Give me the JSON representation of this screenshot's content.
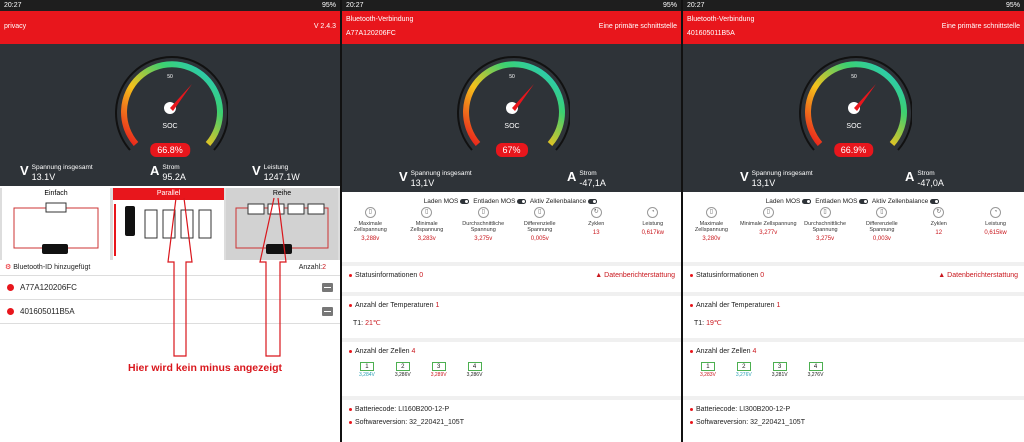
{
  "screen1": {
    "status_time": "20:27",
    "status_right": "95%",
    "header_left": "privacy",
    "header_right": "V 2.4.3",
    "soc_label": "SOC",
    "soc_value": "66.8%",
    "voltage": {
      "label": "Spannung insgesamt",
      "value": "13.1V"
    },
    "current": {
      "label": "Strom",
      "value": "95.2A"
    },
    "power": {
      "label": "Leistung",
      "value": "1247.1W"
    },
    "modes": {
      "single": "Einfach",
      "parallel": "Parallel",
      "series": "Reihe"
    },
    "list_header": "Bluetooth-ID hinzugefügt",
    "count_label": "Anzahl:",
    "count_value": "2",
    "devices": [
      "A77A120206FC",
      "401605011B5A"
    ],
    "annotation": "Hier wird kein minus angezeigt"
  },
  "screen2": {
    "status_time": "20:27",
    "status_right": "95%",
    "header_title": "Bluetooth-Verbindung",
    "header_id": "A77A120206FC",
    "header_right": "Eine primäre schnittstelle",
    "soc_label": "SOC",
    "soc_value": "67%",
    "voltage": {
      "label": "Spannung insgesamt",
      "value": "13,1V"
    },
    "current": {
      "label": "Strom",
      "value": "-47,1A"
    },
    "mos": {
      "charge": "Laden MOS",
      "discharge": "Entladen MOS",
      "balance": "Aktiv Zellenbalance"
    },
    "stats": [
      {
        "label": "Maximale Zellspannung",
        "value": "3,288v"
      },
      {
        "label": "Minimale Zellspannung",
        "value": "3,283v"
      },
      {
        "label": "Durchschnittliche Spannung",
        "value": "3,275v"
      },
      {
        "label": "Differenzielle Spannung",
        "value": "0,005v"
      },
      {
        "label": "Zyklen",
        "value": "13"
      },
      {
        "label": "Leistung",
        "value": "0,617kw"
      }
    ],
    "status_info_label": "Statusinformationen",
    "status_info_value": "0",
    "report_label": "Datenberichterstattung",
    "temp_count_label": "Anzahl der Temperaturen",
    "temp_count_value": "1",
    "temp_label": "T1:",
    "temp_value": "21℃",
    "cell_count_label": "Anzahl der Zellen",
    "cell_count_value": "4",
    "cells": [
      {
        "num": "1",
        "v": "3,284V"
      },
      {
        "num": "2",
        "v": "3,286V"
      },
      {
        "num": "3",
        "v": "3,289V"
      },
      {
        "num": "4",
        "v": "3,286V"
      }
    ],
    "battery_code_label": "Batteriecode:",
    "battery_code": "LI160B200-12-P",
    "software_label": "Softwareversion:",
    "software": "32_220421_105T"
  },
  "screen3": {
    "status_time": "20:27",
    "status_right": "95%",
    "header_title": "Bluetooth-Verbindung",
    "header_id": "401605011B5A",
    "header_right": "Eine primäre schnittstelle",
    "soc_label": "SOC",
    "soc_value": "66.9%",
    "voltage": {
      "label": "Spannung insgesamt",
      "value": "13,1V"
    },
    "current": {
      "label": "Strom",
      "value": "-47,0A"
    },
    "mos": {
      "charge": "Laden MOS",
      "discharge": "Entladen MOS",
      "balance": "Aktiv Zellenbalance"
    },
    "stats": [
      {
        "label": "Maximale Zellspannung",
        "value": "3,280v"
      },
      {
        "label": "Minimale Zellspannung",
        "value": "3,277v"
      },
      {
        "label": "Durchschnittliche Spannung",
        "value": "3,275v"
      },
      {
        "label": "Differenzielle Spannung",
        "value": "0,003v"
      },
      {
        "label": "Zyklen",
        "value": "12"
      },
      {
        "label": "Leistung",
        "value": "0,615kw"
      }
    ],
    "status_info_label": "Statusinformationen",
    "status_info_value": "0",
    "report_label": "Datenberichterstattung",
    "temp_count_label": "Anzahl der Temperaturen",
    "temp_count_value": "1",
    "temp_label": "T1:",
    "temp_value": "19℃",
    "cell_count_label": "Anzahl der Zellen",
    "cell_count_value": "4",
    "cells": [
      {
        "num": "1",
        "v": "3,283V"
      },
      {
        "num": "2",
        "v": "3,276V"
      },
      {
        "num": "3",
        "v": "3,281V"
      },
      {
        "num": "4",
        "v": "3,276V"
      }
    ],
    "battery_code_label": "Batteriecode:",
    "battery_code": "LI300B200-12-P",
    "software_label": "Softwareversion:",
    "software": "32_220421_105T"
  },
  "gauge_ticks": [
    "0",
    "25",
    "50",
    "75",
    "100"
  ],
  "colors": {
    "accent": "#e8161c",
    "dark_panel": "#2e3338",
    "value_red": "#c9161c"
  }
}
